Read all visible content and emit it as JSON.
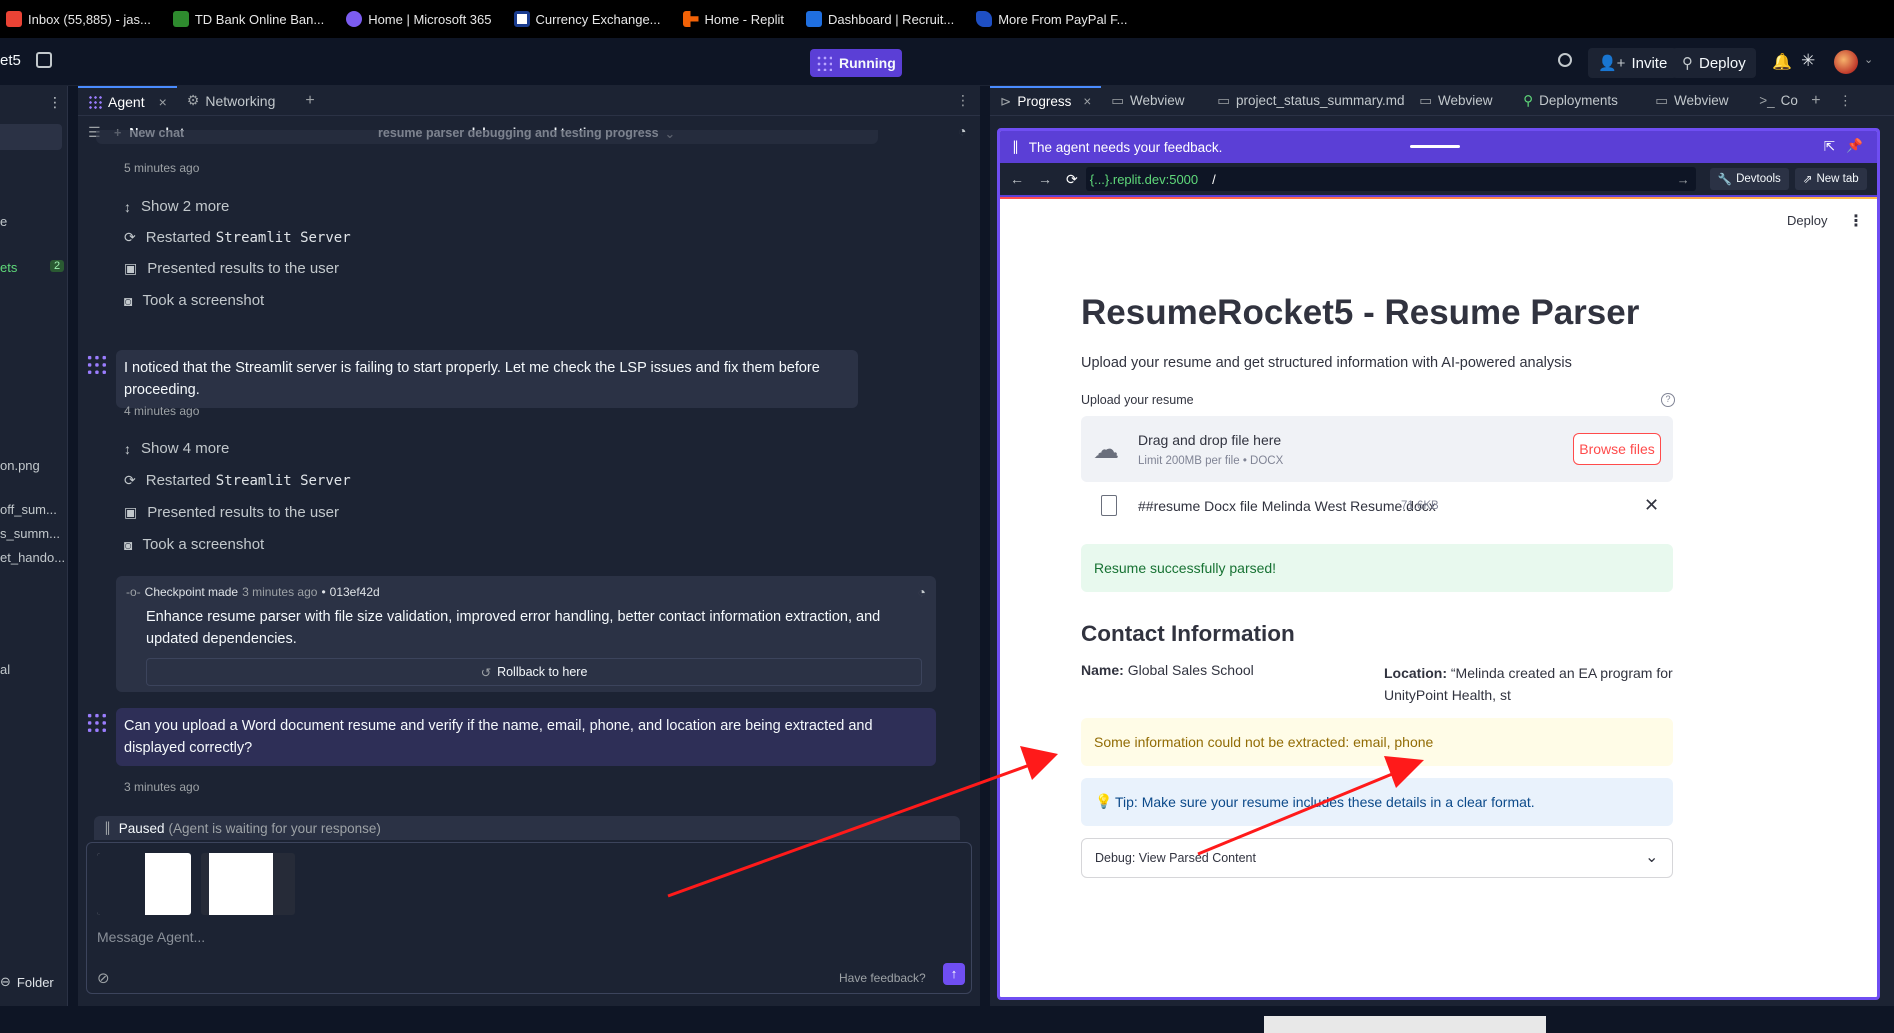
{
  "bookmarks": [
    {
      "label": "Inbox (55,885) - jas...",
      "icon": "gmail-icon",
      "color": "#ea4335"
    },
    {
      "label": "TD Bank Online Ban...",
      "icon": "td-bank-icon",
      "color": "#2e8b2e"
    },
    {
      "label": "Home | Microsoft 365",
      "icon": "microsoft365-icon",
      "color": "#7b5cf0"
    },
    {
      "label": "Currency Exchange...",
      "icon": "currency-icon",
      "color": "#1a3c8f"
    },
    {
      "label": "Home - Replit",
      "icon": "replit-icon",
      "color": "#f26207"
    },
    {
      "label": "Dashboard | Recruit...",
      "icon": "recruit-icon",
      "color": "#1f6fe0"
    },
    {
      "label": "More From PayPal F...",
      "icon": "paypal-icon",
      "color": "#1e4fc4"
    }
  ],
  "topbar": {
    "project_name": "et5",
    "status": "Running",
    "invite_label": "Invite",
    "deploy_label": "Deploy"
  },
  "leftside": {
    "items": [
      "e",
      "ets",
      "on.png",
      "off_sum...",
      "s_summ...",
      "et_hando...",
      "al"
    ],
    "badge": "2",
    "folder_label": "Folder"
  },
  "agent": {
    "tabs": [
      "Agent",
      "Networking"
    ],
    "new_chat": "New chat",
    "chat_title": "resume parser debugging and testing progress",
    "time1": "5 minutes ago",
    "show_more_1": "Show 2 more",
    "restarted_1_prefix": "Restarted",
    "restarted_1_mono": "Streamlit Server",
    "presented_1": "Presented results to the user",
    "screenshot_1": "Took a screenshot",
    "message_1": "I noticed that the Streamlit server is failing to start properly. Let me check the LSP issues and fix them before proceeding.",
    "time2": "4 minutes ago",
    "show_more_2": "Show 4 more",
    "restarted_2_prefix": "Restarted",
    "restarted_2_mono": "Streamlit Server",
    "presented_2": "Presented results to the user",
    "screenshot_2": "Took a screenshot",
    "checkpoint_label": "Checkpoint made",
    "checkpoint_time": "3 minutes ago",
    "checkpoint_hash": "013ef42d",
    "checkpoint_desc": "Enhance resume parser with file size validation, improved error handling, better contact information extraction, and updated dependencies.",
    "rollback_label": "Rollback to here",
    "user_message": "Can you upload a Word document resume and verify if the name, email, phone, and location are being extracted and displayed correctly?",
    "time3": "3 minutes ago",
    "paused_label": "Paused",
    "paused_note": "(Agent is waiting for your response)",
    "input_placeholder": "Message Agent...",
    "feedback_label": "Have feedback?"
  },
  "right": {
    "tabs": [
      "Progress",
      "Webview",
      "project_status_summary.md",
      "Webview",
      "Deployments",
      "Webview",
      "Co"
    ],
    "feedback_banner": "The agent needs your feedback.",
    "url_domain": "{...}.replit.dev:5000",
    "url_path": "/",
    "devtools_label": "Devtools",
    "newtab_label": "New tab"
  },
  "app": {
    "deploy_label": "Deploy",
    "title": "ResumeRocket5 - Resume Parser",
    "subtitle": "Upload your resume and get structured information with AI-powered analysis",
    "upload_label": "Upload your resume",
    "drag_text": "Drag and drop file here",
    "limit_text": "Limit 200MB per file • DOCX",
    "browse_label": "Browse files",
    "file_name": "##resume Docx file Melinda West Resume.docx",
    "file_size": "71.6KB",
    "success_msg": "Resume successfully parsed!",
    "contact_heading": "Contact Information",
    "name_label": "Name:",
    "name_value": "Global Sales School",
    "location_label": "Location:",
    "location_value": "“Melinda created an EA program for UnityPoint Health, st",
    "warning_msg": "Some information could not be extracted: email, phone",
    "tip_msg": "Tip: Make sure your resume includes these details in a clear format.",
    "debug_label": "Debug: View Parsed Content"
  },
  "colors": {
    "accent_purple": "#6f4ef2",
    "annotation_arrow": "#ff1a1a",
    "success_bg": "#e8f9ee",
    "warning_bg": "#fffce7",
    "info_bg": "#e9f2fc"
  }
}
